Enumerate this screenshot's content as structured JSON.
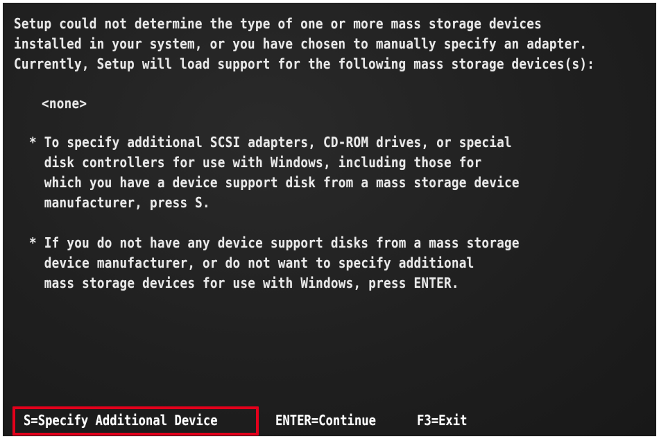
{
  "screen": {
    "intro_lines": [
      "Setup could not determine the type of one or more mass storage devices",
      "installed in your system, or you have chosen to manually specify an adapter.",
      "Currently, Setup will load support for the following mass storage devices(s):"
    ],
    "device_list": "<none>",
    "bullet_1_lines": [
      "* To specify additional SCSI adapters, CD-ROM drives, or special",
      "  disk controllers for use with Windows, including those for",
      "  which you have a device support disk from a mass storage device",
      "  manufacturer, press S."
    ],
    "bullet_2_lines": [
      "* If you do not have any device support disks from a mass storage",
      "  device manufacturer, or do not want to specify additional",
      "  mass storage devices for use with Windows, press ENTER."
    ]
  },
  "footer": {
    "specify_key": "S=Specify Additional Device",
    "continue_key": "ENTER=Continue",
    "exit_key": "F3=Exit"
  },
  "colors": {
    "background": "#1f1f1f",
    "text": "#e9e9e9",
    "highlight": "#e3001b"
  }
}
